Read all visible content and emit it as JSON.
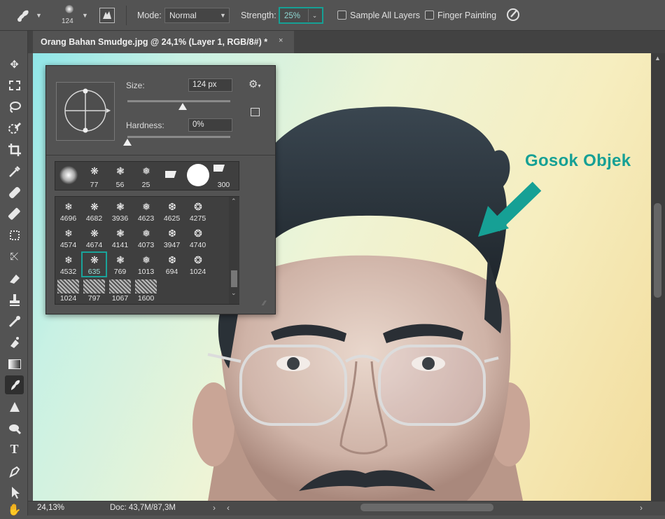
{
  "options_bar": {
    "brush_size": "124",
    "mode_label": "Mode:",
    "mode_value": "Normal",
    "strength_label": "Strength:",
    "strength_value": "25%",
    "sample_all_layers": "Sample All Layers",
    "finger_painting": "Finger Painting"
  },
  "document_tab": {
    "title": "Orang Bahan Smudge.jpg @ 24,1% (Layer 1, RGB/8#) *",
    "close": "×"
  },
  "brush_panel": {
    "size_label": "Size:",
    "size_value": "124 px",
    "size_fraction": 0.54,
    "hardness_label": "Hardness:",
    "hardness_value": "0%",
    "hardness_fraction": 0.0,
    "recent_brushes": [
      "",
      "77",
      "56",
      "25",
      "",
      "",
      "300"
    ],
    "presets": [
      [
        "4696",
        "4682",
        "3936",
        "4623",
        "4625",
        "4275"
      ],
      [
        "4574",
        "4674",
        "4141",
        "4073",
        "3947",
        "4740"
      ],
      [
        "4532",
        "635",
        "769",
        "1013",
        "694",
        "1024"
      ],
      [
        "1024",
        "797",
        "1067",
        "1600"
      ]
    ],
    "selected_preset": "635"
  },
  "annotation": "Gosok Objek",
  "status": {
    "zoom": "24,13%",
    "doc": "Doc: 43,7M/87,3M"
  },
  "accent_color": "#16a095"
}
